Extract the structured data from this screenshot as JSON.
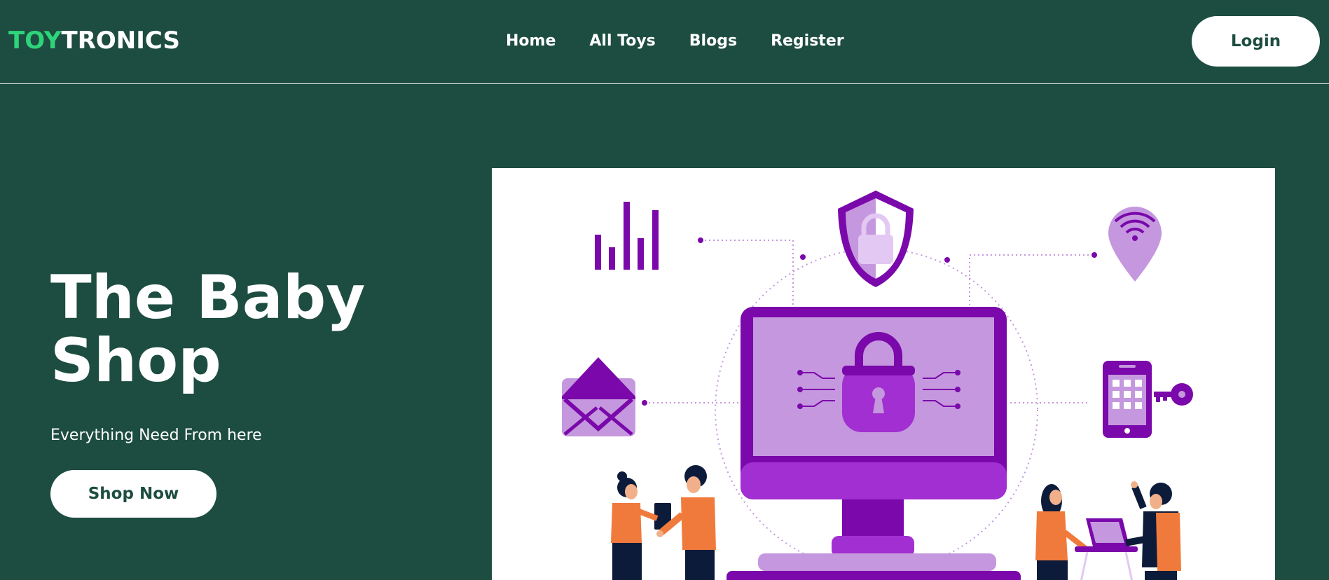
{
  "brand": {
    "part1": "TOY",
    "part2": "TRONICS"
  },
  "nav": {
    "links": [
      "Home",
      "All Toys",
      "Blogs",
      "Register"
    ],
    "login_label": "Login"
  },
  "hero": {
    "title": "The Baby Shop",
    "subtitle": "Everything Need From here",
    "cta_label": "Shop Now"
  },
  "colors": {
    "background": "#1d4d40",
    "brand_accent": "#2ed47a",
    "button_bg": "#ffffff",
    "button_text": "#1d4d40",
    "illustration_purple": "#7a08aa",
    "illustration_lilac": "#c597de",
    "illustration_orange": "#f07a3c"
  },
  "illustration": {
    "icons": [
      "bar-chart-icon",
      "shield-lock-icon",
      "location-wifi-icon",
      "envelope-icon",
      "monitor-padlock-icon",
      "phone-key-icon",
      "people-figures"
    ]
  }
}
